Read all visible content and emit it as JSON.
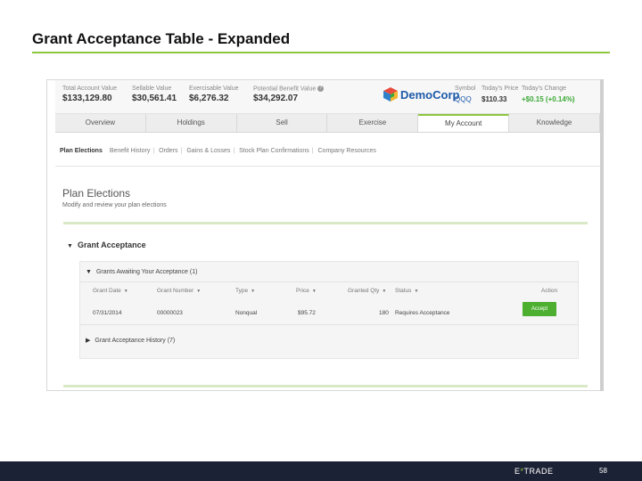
{
  "slide": {
    "title": "Grant Acceptance Table - Expanded",
    "page_number": "58"
  },
  "summary": {
    "metrics": [
      {
        "label": "Total Account Value",
        "value": "$133,129.80"
      },
      {
        "label": "Sellable Value",
        "value": "$30,561.41"
      },
      {
        "label": "Exercisable Value",
        "value": "$6,276.32"
      },
      {
        "label": "Potential Benefit Value",
        "value": "$34,292.07"
      }
    ],
    "brand": "DemoCorp",
    "quote": {
      "symbol_label": "Symbol",
      "symbol": "QQQ",
      "price_label": "Today's Price",
      "price": "$110.33",
      "change_label": "Today's Change",
      "change": "+$0.15 (+0.14%)"
    }
  },
  "tabs": [
    "Overview",
    "Holdings",
    "Sell",
    "Exercise",
    "My Account",
    "Knowledge"
  ],
  "subnav": [
    "Plan Elections",
    "Benefit History",
    "Orders",
    "Gains & Losses",
    "Stock Plan Confirmations",
    "Company Resources"
  ],
  "page": {
    "heading": "Plan Elections",
    "subheading": "Modify and review your plan elections"
  },
  "section": {
    "title": "Grant Acceptance",
    "awaiting_title": "Grants Awaiting Your Acceptance (1)",
    "columns": [
      "Grant Date",
      "Grant Number",
      "Type",
      "Price",
      "Granted Qty",
      "Status",
      "Action"
    ],
    "rows": [
      {
        "grant_date": "07/31/2014",
        "grant_number": "00000023",
        "type": "Nonqual",
        "price": "$95.72",
        "granted_qty": "180",
        "status": "Requires Acceptance",
        "action": "Accept"
      }
    ],
    "history_title": "Grant Acceptance History (7)"
  },
  "footer": {
    "logo_left": "E",
    "logo_star": "*",
    "logo_right": "TRADE"
  },
  "colors": {
    "accent_green": "#8dc63f",
    "button_green": "#4caf2f",
    "brand_blue": "#1e5aa8",
    "footer_navy": "#1c2235"
  }
}
